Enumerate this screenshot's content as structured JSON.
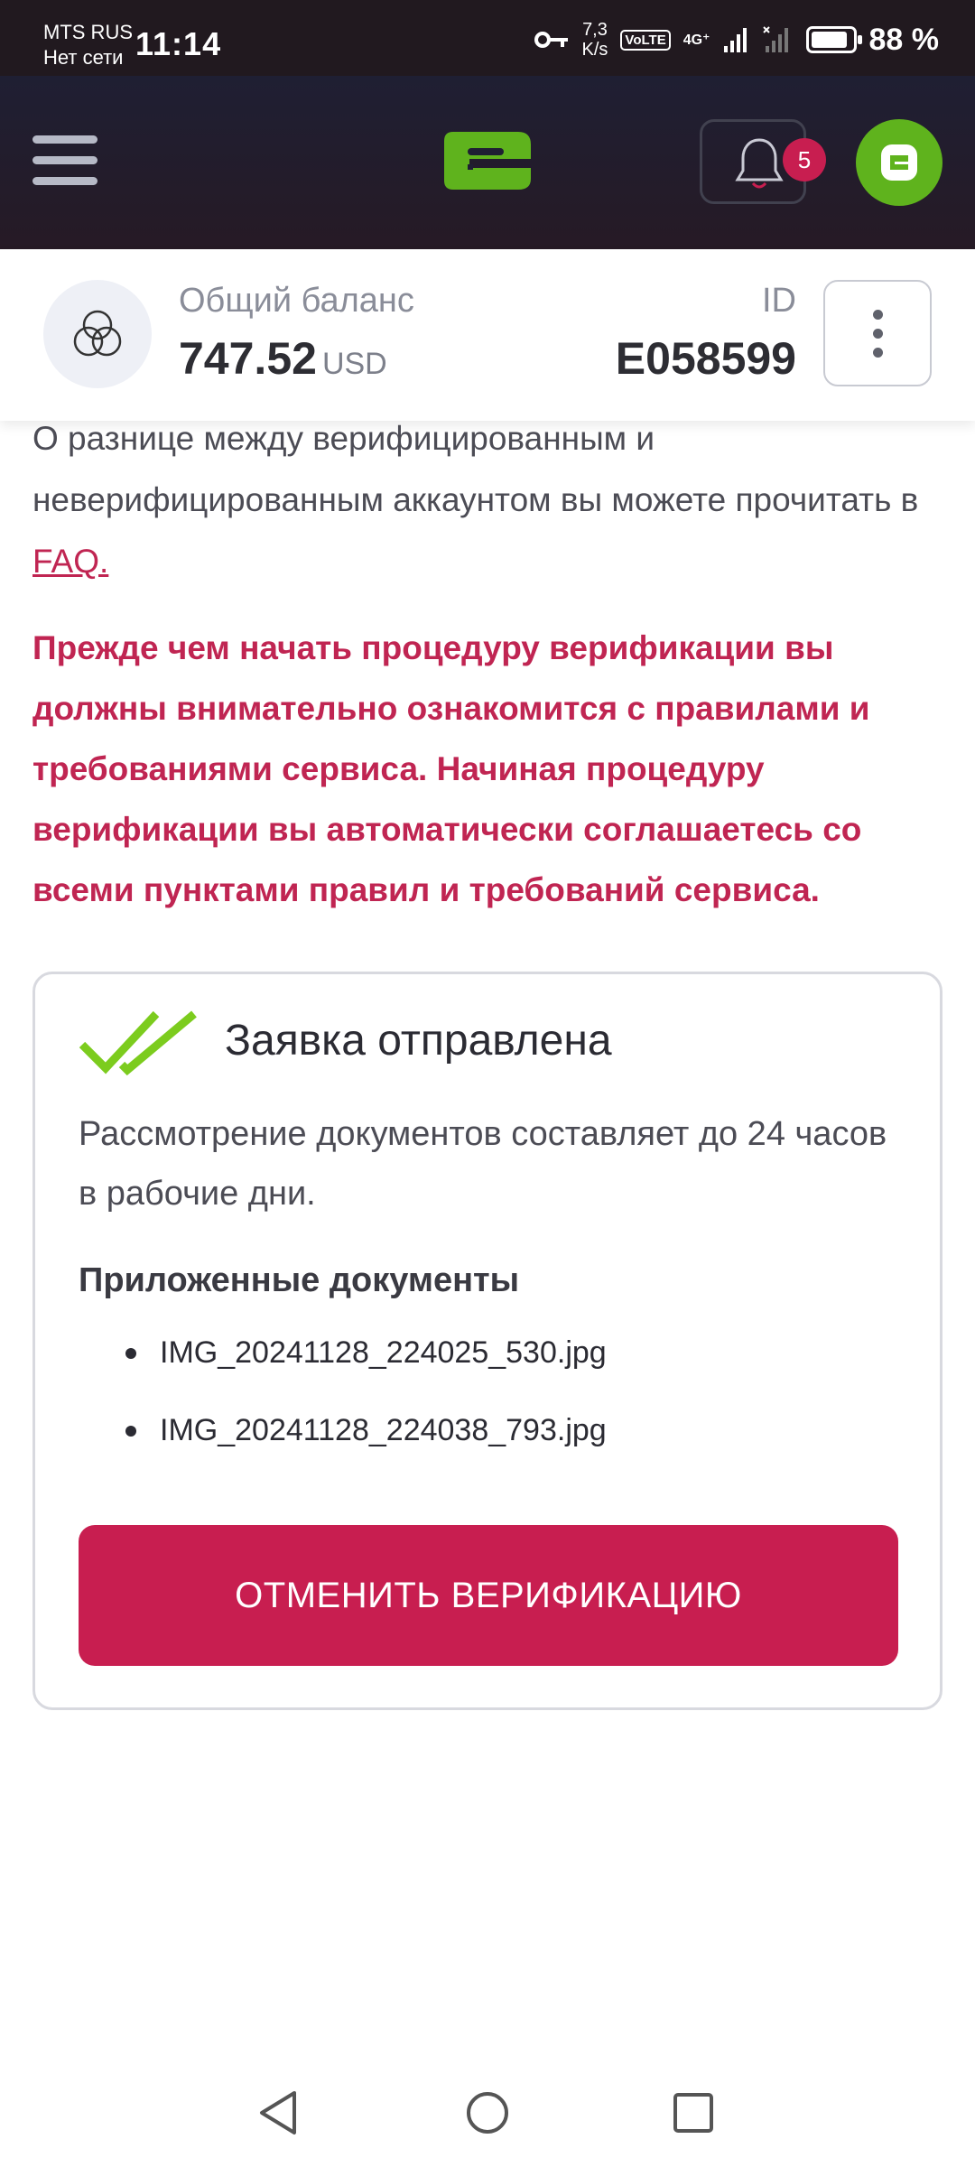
{
  "status_bar": {
    "carrier": "MTS RUS",
    "carrier_status": "Нет сети",
    "time": "11:14",
    "speed_value": "7,3",
    "speed_unit": "K/s",
    "volte": "VoLTE",
    "network": "4G⁺",
    "battery_percent": "88 %",
    "battery_level": 0.88
  },
  "header": {
    "notification_count": "5",
    "accent_color": "#5fb31d"
  },
  "balance": {
    "label": "Общий баланс",
    "amount": "747.52",
    "currency": "USD",
    "id_label": "ID",
    "id_value": "E058599"
  },
  "content": {
    "intro_text": "О разнице между верифицированным и неверифицированным аккаунтом вы можете прочитать в ",
    "faq_link": "FAQ.",
    "warning": "Прежде чем начать процедуру верификации вы должны внимательно ознакомится с правилами и требованиями сервиса. Начиная процедуру верификации вы автоматически соглашаетесь со всеми пунктами правил и требований сервиса.",
    "warning_color": "#c02552"
  },
  "card": {
    "title": "Заявка отправлена",
    "description": "Рассмотрение документов составляет до 24 часов в рабочие дни.",
    "docs_title": "Приложенные документы",
    "documents": [
      "IMG_20241128_224025_530.jpg",
      "IMG_20241128_224038_793.jpg"
    ],
    "cancel_button": "ОТМЕНИТЬ ВЕРИФИКАЦИЮ",
    "button_color": "#c81e50"
  },
  "icons": {
    "menu": "hamburger-icon",
    "logo": "brand-logo",
    "bell": "bell-icon",
    "avatar": "wallet-icon",
    "balance": "triple-circle-icon",
    "more": "kebab-icon",
    "check": "double-check-icon",
    "nav": [
      "back-triangle-icon",
      "home-circle-icon",
      "recents-square-icon"
    ]
  }
}
